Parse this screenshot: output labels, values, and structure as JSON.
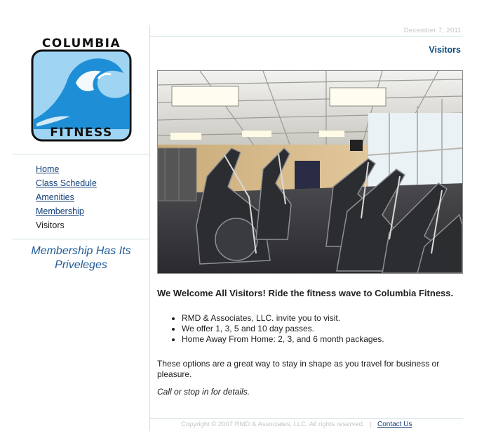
{
  "sidebar": {
    "logo": {
      "line1": "COLUMBIA",
      "line2": "FITNESS"
    },
    "nav": [
      {
        "label": "Home"
      },
      {
        "label": "Class Schedule"
      },
      {
        "label": "Amenities"
      },
      {
        "label": "Membership"
      },
      {
        "label": "Visitors",
        "current": true
      }
    ],
    "tagline_line1": "Membership Has Its",
    "tagline_line2": "Priveleges"
  },
  "header": {
    "date": "December 7, 2011",
    "page_title": "Visitors"
  },
  "content": {
    "photo_icon": "gym-photo",
    "welcome": "We Welcome All Visitors! Ride the fitness wave to Columbia Fitness.",
    "bullets": [
      "RMD & Associates, LLC. invite you to visit.",
      "We offer 1, 3, 5 and 10 day passes.",
      "Home Away From Home: 2, 3, and 6 month packages."
    ],
    "paragraph": "These options are a great way to stay in shape as you travel for business or pleasure.",
    "call": "Call or stop in for details."
  },
  "footer": {
    "copyright": "Copyright © 2007 RMD & Associates, LLC. All rights reserved.",
    "separator": "|",
    "contact": "Contact Us"
  },
  "colors": {
    "link": "#12407a",
    "heading": "#0c4a7c",
    "tagline": "#1f5b96",
    "wave_dark": "#1e8fd6",
    "wave_light": "#9fd4f3",
    "rule": "#cfe0e5"
  }
}
